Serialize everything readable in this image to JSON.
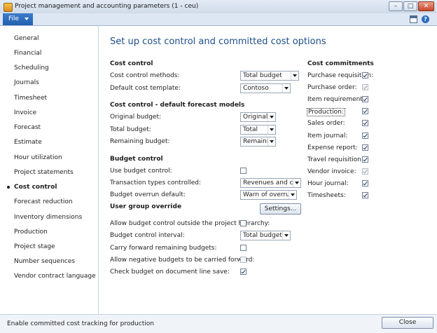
{
  "window": {
    "title": "Project management and accounting parameters (1 - ceu)",
    "minimize_label": "–",
    "maximize_label": "□",
    "close_label": "✕"
  },
  "ribbon": {
    "file_label": "File"
  },
  "nav": {
    "items": [
      {
        "label": "General"
      },
      {
        "label": "Financial"
      },
      {
        "label": "Scheduling"
      },
      {
        "label": "Journals"
      },
      {
        "label": "Timesheet"
      },
      {
        "label": "Invoice"
      },
      {
        "label": "Forecast"
      },
      {
        "label": "Estimate"
      },
      {
        "label": "Hour utilization"
      },
      {
        "label": "Project statements"
      },
      {
        "label": "Cost control"
      },
      {
        "label": "Forecast reduction"
      },
      {
        "label": "Inventory dimensions"
      },
      {
        "label": "Production"
      },
      {
        "label": "Project stage"
      },
      {
        "label": "Number sequences"
      },
      {
        "label": "Vendor contract language"
      }
    ],
    "active": "Cost control"
  },
  "main": {
    "heading": "Set up cost control and committed cost options",
    "cost_control": {
      "title": "Cost control",
      "methods_label": "Cost control methods:",
      "methods_value": "Total budget",
      "template_label": "Default cost template:",
      "template_value": "Contoso"
    },
    "forecast_models": {
      "title": "Cost control - default forecast models",
      "original_label": "Original budget:",
      "original_value": "Original",
      "total_label": "Total budget:",
      "total_value": "Total",
      "remaining_label": "Remaining budget:",
      "remaining_value": "Remainin"
    },
    "budget_control": {
      "title": "Budget control",
      "use_label": "Use budget control:",
      "use_checked": false,
      "types_label": "Transaction types controlled:",
      "types_value": "Revenues and costs",
      "overrun_label": "Budget overrun default:",
      "overrun_value": "Warn of overruns",
      "user_group_label": "User group override",
      "settings_button": "Settings...",
      "allow_outside_label": "Allow budget control outside the project hierarchy:",
      "allow_outside_checked": false,
      "interval_label": "Budget control interval:",
      "interval_value": "Total budget",
      "carry_forward_label": "Carry forward remaining budgets:",
      "carry_forward_checked": false,
      "allow_negative_label": "Allow negative budgets to be carried forward:",
      "allow_negative_checked": false,
      "check_line_label": "Check budget on document line save:",
      "check_line_checked": true
    },
    "commitments": {
      "title": "Cost commitments",
      "items": [
        {
          "label": "Purchase requisition:",
          "checked": true,
          "disabled": false
        },
        {
          "label": "Purchase order:",
          "checked": true,
          "disabled": true
        },
        {
          "label": "Item requirement:",
          "checked": true,
          "disabled": false
        },
        {
          "label": "Production:",
          "checked": true,
          "disabled": false
        },
        {
          "label": "Sales order:",
          "checked": true,
          "disabled": false
        },
        {
          "label": "Item journal:",
          "checked": true,
          "disabled": false
        },
        {
          "label": "Expense report:",
          "checked": true,
          "disabled": false
        },
        {
          "label": "Travel requisition:",
          "checked": true,
          "disabled": false
        },
        {
          "label": "Vendor invoice:",
          "checked": true,
          "disabled": true
        },
        {
          "label": "Hour journal:",
          "checked": true,
          "disabled": false
        },
        {
          "label": "Timesheets:",
          "checked": true,
          "disabled": false
        }
      ]
    }
  },
  "status": {
    "text": "Enable committed cost tracking for production",
    "close_button": "Close"
  }
}
